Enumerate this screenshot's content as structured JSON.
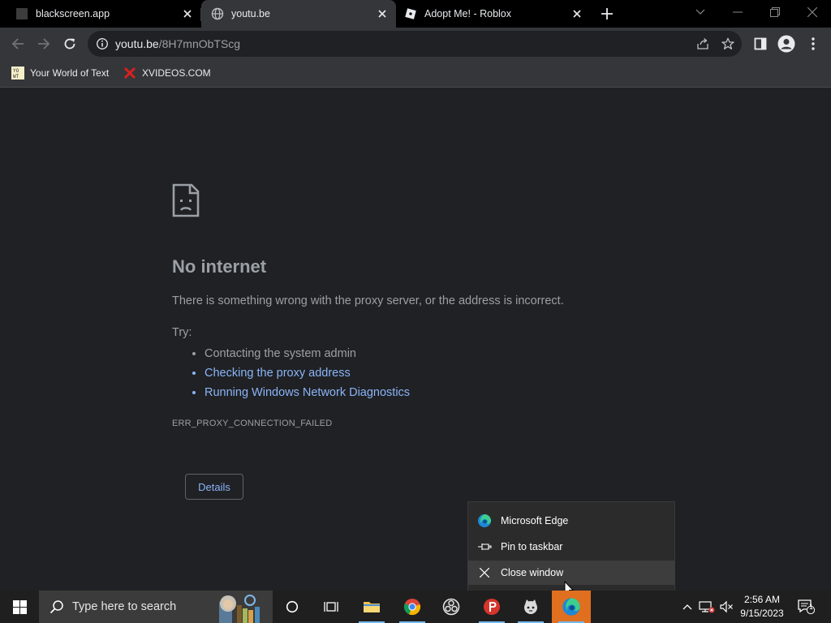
{
  "tabs": [
    {
      "title": "blackscreen.app",
      "favicon": "black-square-icon"
    },
    {
      "title": "youtu.be",
      "favicon": "globe-icon",
      "active": true
    },
    {
      "title": "Adopt Me! - Roblox",
      "favicon": "roblox-icon"
    }
  ],
  "address_bar": {
    "host": "youtu.be",
    "path": "/8H7mnObTScg"
  },
  "bookmarks": [
    {
      "label": "Your World of Text",
      "icon": "ywot-icon"
    },
    {
      "label": "XVIDEOS.COM",
      "icon": "x-logo-icon"
    }
  ],
  "error_page": {
    "title": "No internet",
    "message": "There is something wrong with the proxy server, or the address is incorrect.",
    "try_label": "Try:",
    "suggestions": [
      "Contacting the system admin",
      "Checking the proxy address",
      "Running Windows Network Diagnostics"
    ],
    "error_code": "ERR_PROXY_CONNECTION_FAILED",
    "details_button": "Details"
  },
  "jump_list": {
    "items": [
      {
        "label": "Microsoft Edge",
        "icon": "edge-icon"
      },
      {
        "label": "Pin to taskbar",
        "icon": "pin-icon"
      },
      {
        "label": "Close window",
        "icon": "close-icon"
      }
    ]
  },
  "taskbar": {
    "search_placeholder": "Type here to search",
    "time": "2:56 AM",
    "date": "9/15/2023",
    "notification_count": "1"
  },
  "colors": {
    "accent_link": "#8ab4f8",
    "active_taskbar": "#e06f20",
    "background": "#202124"
  }
}
